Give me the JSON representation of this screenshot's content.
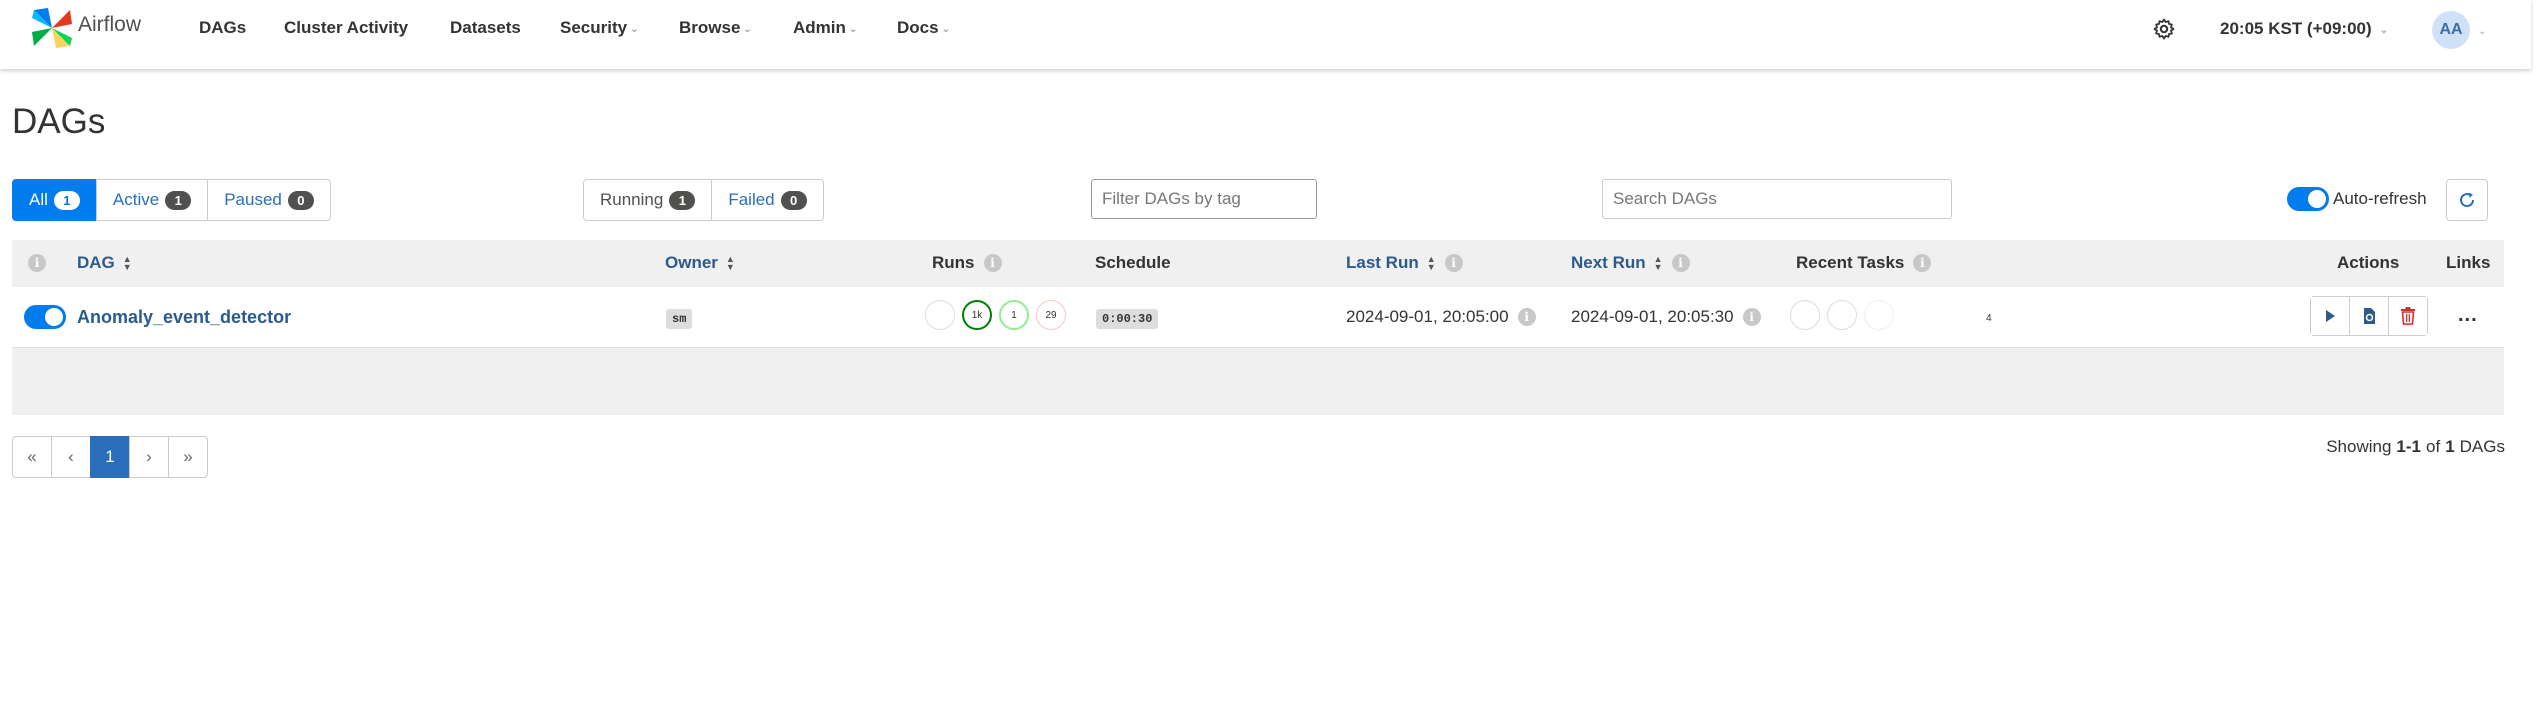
{
  "navbar": {
    "brand": "Airflow",
    "items": [
      {
        "label": "DAGs",
        "dropdown": false
      },
      {
        "label": "Cluster Activity",
        "dropdown": false
      },
      {
        "label": "Datasets",
        "dropdown": false
      },
      {
        "label": "Security",
        "dropdown": true
      },
      {
        "label": "Browse",
        "dropdown": true
      },
      {
        "label": "Admin",
        "dropdown": true
      },
      {
        "label": "Docs",
        "dropdown": true
      }
    ],
    "clock": "20:05 KST (+09:00)",
    "avatar": "AA",
    "dropdown_icon": "chevron-down-icon"
  },
  "page": {
    "title": "DAGs"
  },
  "status_filters": [
    {
      "label": "All",
      "count": "1"
    },
    {
      "label": "Active",
      "count": "1"
    },
    {
      "label": "Paused",
      "count": "0"
    }
  ],
  "run_filters": [
    {
      "label": "Running",
      "count": "1"
    },
    {
      "label": "Failed",
      "count": "0"
    }
  ],
  "tag_filter": {
    "placeholder": "Filter DAGs by tag"
  },
  "search": {
    "placeholder": "Search DAGs"
  },
  "auto_refresh": {
    "label": "Auto-refresh",
    "enabled": true
  },
  "table": {
    "headers": {
      "dag": "DAG",
      "owner": "Owner",
      "runs": "Runs",
      "schedule": "Schedule",
      "last_run": "Last Run",
      "next_run": "Next Run",
      "recent_tasks": "Recent Tasks",
      "actions": "Actions",
      "links": "Links"
    },
    "info_symbol": "i",
    "rows": [
      {
        "active": true,
        "dag_id": "Anomaly_event_detector",
        "owner": "sm",
        "runs": [
          "",
          "1k",
          "1",
          "29"
        ],
        "schedule": "0:00:30",
        "last_run": "2024-09-01, 20:05:00",
        "next_run": "2024-09-01, 20:05:30",
        "recent_task_count": "4",
        "links": "..."
      }
    ]
  },
  "pagination": {
    "first": "«",
    "prev": "‹",
    "current": "1",
    "next": "›",
    "last": "»"
  },
  "showing": {
    "prefix": "Showing",
    "range": "1-1",
    "of": "of",
    "total": "1",
    "suffix": "DAGs"
  },
  "colors": {
    "primary": "#017cee",
    "link": "#2a5b8c",
    "success": "#008000",
    "running": "#90ee90",
    "failed": "#d32f2f"
  }
}
